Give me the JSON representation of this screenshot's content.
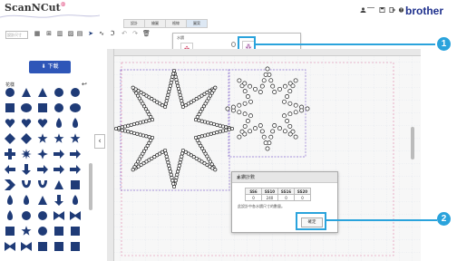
{
  "header": {
    "logo_text": "ScanNCut",
    "brand": "brother",
    "icons": [
      "user-icon",
      "save-icon",
      "logout-icon",
      "help-icon"
    ]
  },
  "menu_tabs": [
    {
      "label": "設計"
    },
    {
      "label": "繪圖"
    },
    {
      "label": "格線"
    },
    {
      "label": "圖案"
    }
  ],
  "toolbar": {
    "size_placeholder": "設計尺寸",
    "tools": [
      "grid-icon",
      "align-icon",
      "trash-icon",
      "image-icon",
      "pointer-icon",
      "curve-icon",
      "text-icon",
      "undo-icon",
      "redo-icon",
      "delete-icon"
    ]
  },
  "popup": {
    "title": "水鑽"
  },
  "sidebar": {
    "download_label": "下載",
    "section_title": "花樣",
    "undo_label": "↩"
  },
  "dialog": {
    "title": "水鑽計數",
    "columns": [
      "SS6",
      "SS10",
      "SS16",
      "SS20"
    ],
    "values": [
      "0",
      "240",
      "0",
      "0"
    ],
    "message": "此設計中各水鑽尺寸的數量。",
    "ok_label": "確定"
  },
  "callouts": [
    "1",
    "2"
  ],
  "colors": {
    "accent": "#2aa3dc",
    "navy": "#1f3b77",
    "brand": "#1d2f8c",
    "button": "#2e56b8"
  }
}
